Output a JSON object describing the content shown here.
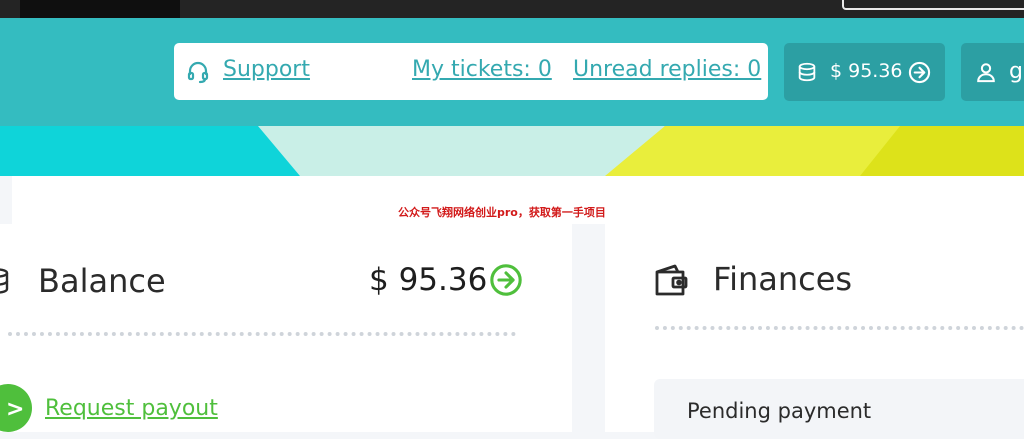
{
  "header": {
    "support_label": "Support",
    "my_tickets": "My tickets: 0",
    "unread_replies": "Unread replies: 0",
    "balance": "$ 95.36",
    "user_initial": "g"
  },
  "watermark": "公众号飞翔网络创业pro，获取第一手项目",
  "balance_card": {
    "title": "Balance",
    "amount": "$ 95.36",
    "payout_link": "Request payout"
  },
  "finances_card": {
    "title": "Finances",
    "pending_label": "Pending payment"
  },
  "colors": {
    "header_bg": "#34bcc0",
    "pill_dark": "#2c9fa3",
    "link": "#34a9b0",
    "accent_green": "#4fbf3c"
  }
}
